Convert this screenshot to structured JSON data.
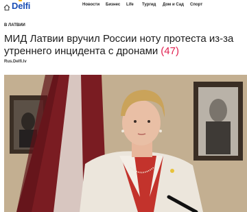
{
  "brand": {
    "name_left": "D",
    "name_mid": "e",
    "name_right": "lfi"
  },
  "nav": {
    "items": [
      "Новости",
      "Бизнес",
      "Life",
      "Тургид",
      "Дом и Сад",
      "Спорт"
    ]
  },
  "article": {
    "section": "В ЛАТВИИ",
    "title": "МИД Латвии вручил России ноту протеста из-за утреннего инцидента с дронами",
    "comments_count": "(47)",
    "source": "Rus.Delfi.lv"
  },
  "colors": {
    "brand_blue": "#1b4fb5",
    "brand_yellow": "#f3b31c",
    "accent_red": "#e02050"
  },
  "icons": {
    "home": "home-icon"
  }
}
